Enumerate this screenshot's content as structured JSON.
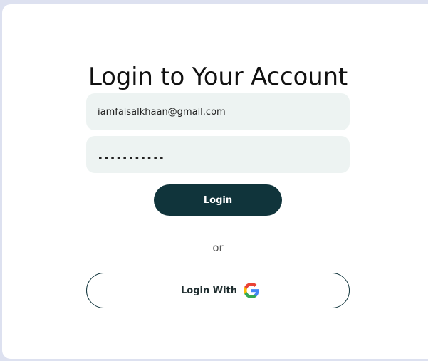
{
  "login": {
    "title": "Login to Your Account",
    "email_value": "iamfaisalkhaan@gmail.com",
    "password_value": "...........",
    "login_label": "Login",
    "divider_text": "or",
    "google_label": "Login With",
    "google_icon": "google-icon"
  },
  "colors": {
    "background": "#dde1f0",
    "card": "#ffffff",
    "field": "#edf3f2",
    "primary": "#10343b"
  }
}
